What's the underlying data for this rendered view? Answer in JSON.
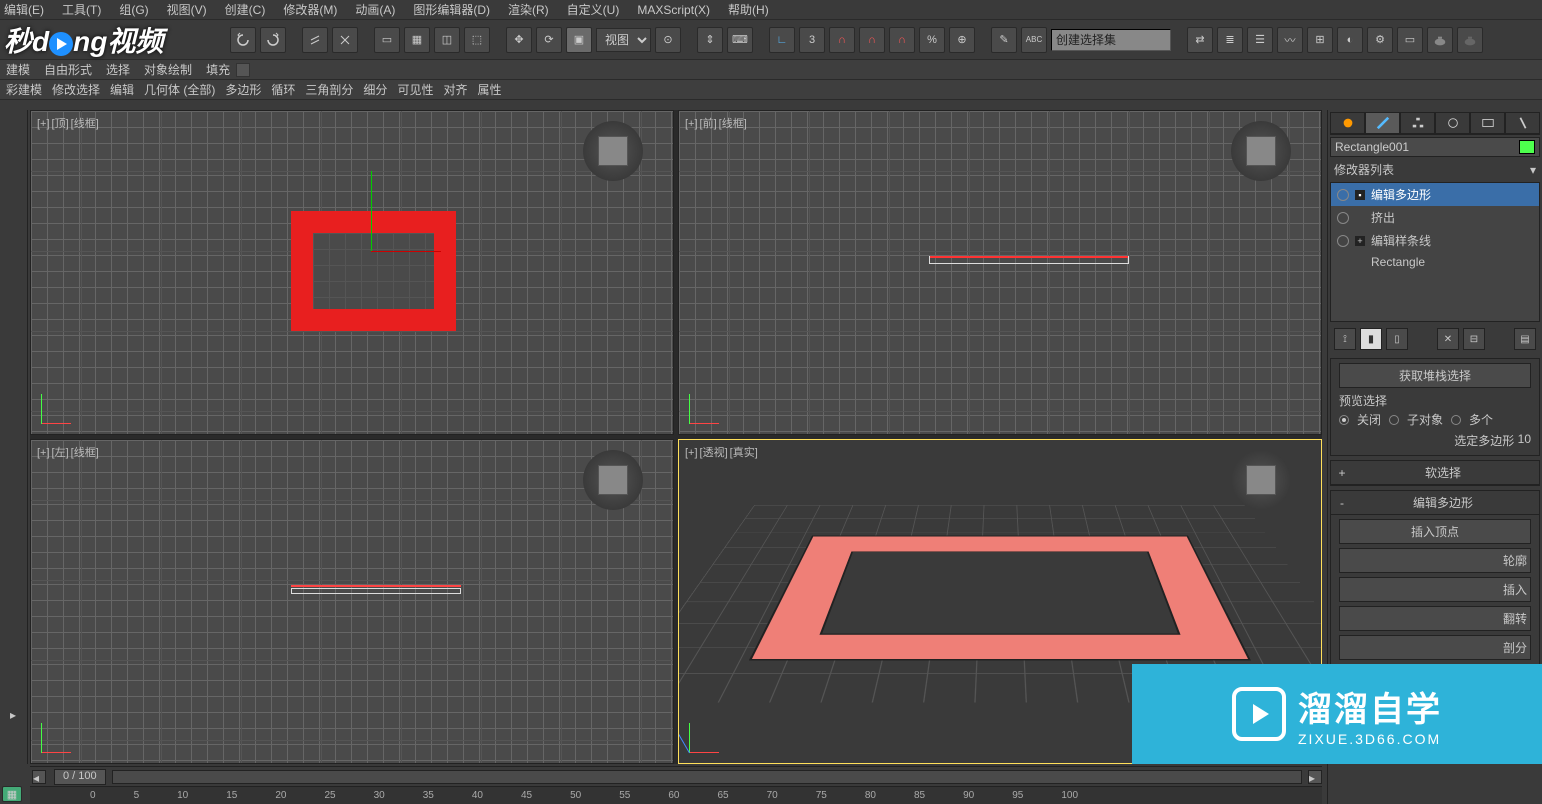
{
  "menu": {
    "edit": "编辑(E)",
    "tools": "工具(T)",
    "group": "组(G)",
    "views": "视图(V)",
    "create": "创建(C)",
    "modifiers": "修改器(M)",
    "animation": "动画(A)",
    "graph": "图形编辑器(D)",
    "rendering": "渲染(R)",
    "customize": "自定义(U)",
    "maxscript": "MAXScript(X)",
    "help": "帮助(H)"
  },
  "logo": "秒d  ng视频",
  "toolbar": {
    "view_dd": "视图",
    "angle": "3",
    "selset": "创建选择集"
  },
  "ribbon": {
    "modeling": "建模",
    "freeform": "自由形式",
    "select": "选择",
    "objpaint": "对象绘制",
    "fill": "填充"
  },
  "ribbon2": {
    "polymod": "彩建模",
    "modsel": "修改选择",
    "edit": "编辑",
    "geomall": "几何体 (全部)",
    "poly": "多边形",
    "loop": "循环",
    "tri": "三角剖分",
    "subdiv": "细分",
    "vis": "可见性",
    "align": "对齐",
    "prop": "属性"
  },
  "viewports": {
    "top": {
      "l1": "[+]",
      "l2": "[顶]",
      "l3": "[线框]"
    },
    "front": {
      "l1": "[+]",
      "l2": "[前]",
      "l3": "[线框]"
    },
    "left": {
      "l1": "[+]",
      "l2": "[左]",
      "l3": "[线框]"
    },
    "persp": {
      "l1": "[+]",
      "l2": "[透视]",
      "l3": "[真实]"
    }
  },
  "panel": {
    "objname": "Rectangle001",
    "modlist_label": "修改器列表",
    "mods": {
      "m0": "编辑多边形",
      "m1": "挤出",
      "m2": "编辑样条线",
      "m3": "Rectangle"
    },
    "stacksel": "获取堆栈选择",
    "preview": "预览选择",
    "off": "关闭",
    "subobj": "子对象",
    "multi": "多个",
    "selpoly": "选定多边形",
    "selcount": "10",
    "softsel": "软选择",
    "editpoly": "编辑多边形",
    "insvert": "插入顶点",
    "outline": "轮廓",
    "insert": "插入",
    "flip": "翻转",
    "other": "剖分"
  },
  "timeline": {
    "frame": "0 / 100"
  },
  "ruler": [
    "0",
    "5",
    "10",
    "15",
    "20",
    "25",
    "30",
    "35",
    "40",
    "45",
    "50",
    "55",
    "60",
    "65",
    "70",
    "75",
    "80",
    "85",
    "90",
    "95",
    "100"
  ],
  "zixue": {
    "big": "溜溜自学",
    "small": "ZIXUE.3D66.COM"
  }
}
